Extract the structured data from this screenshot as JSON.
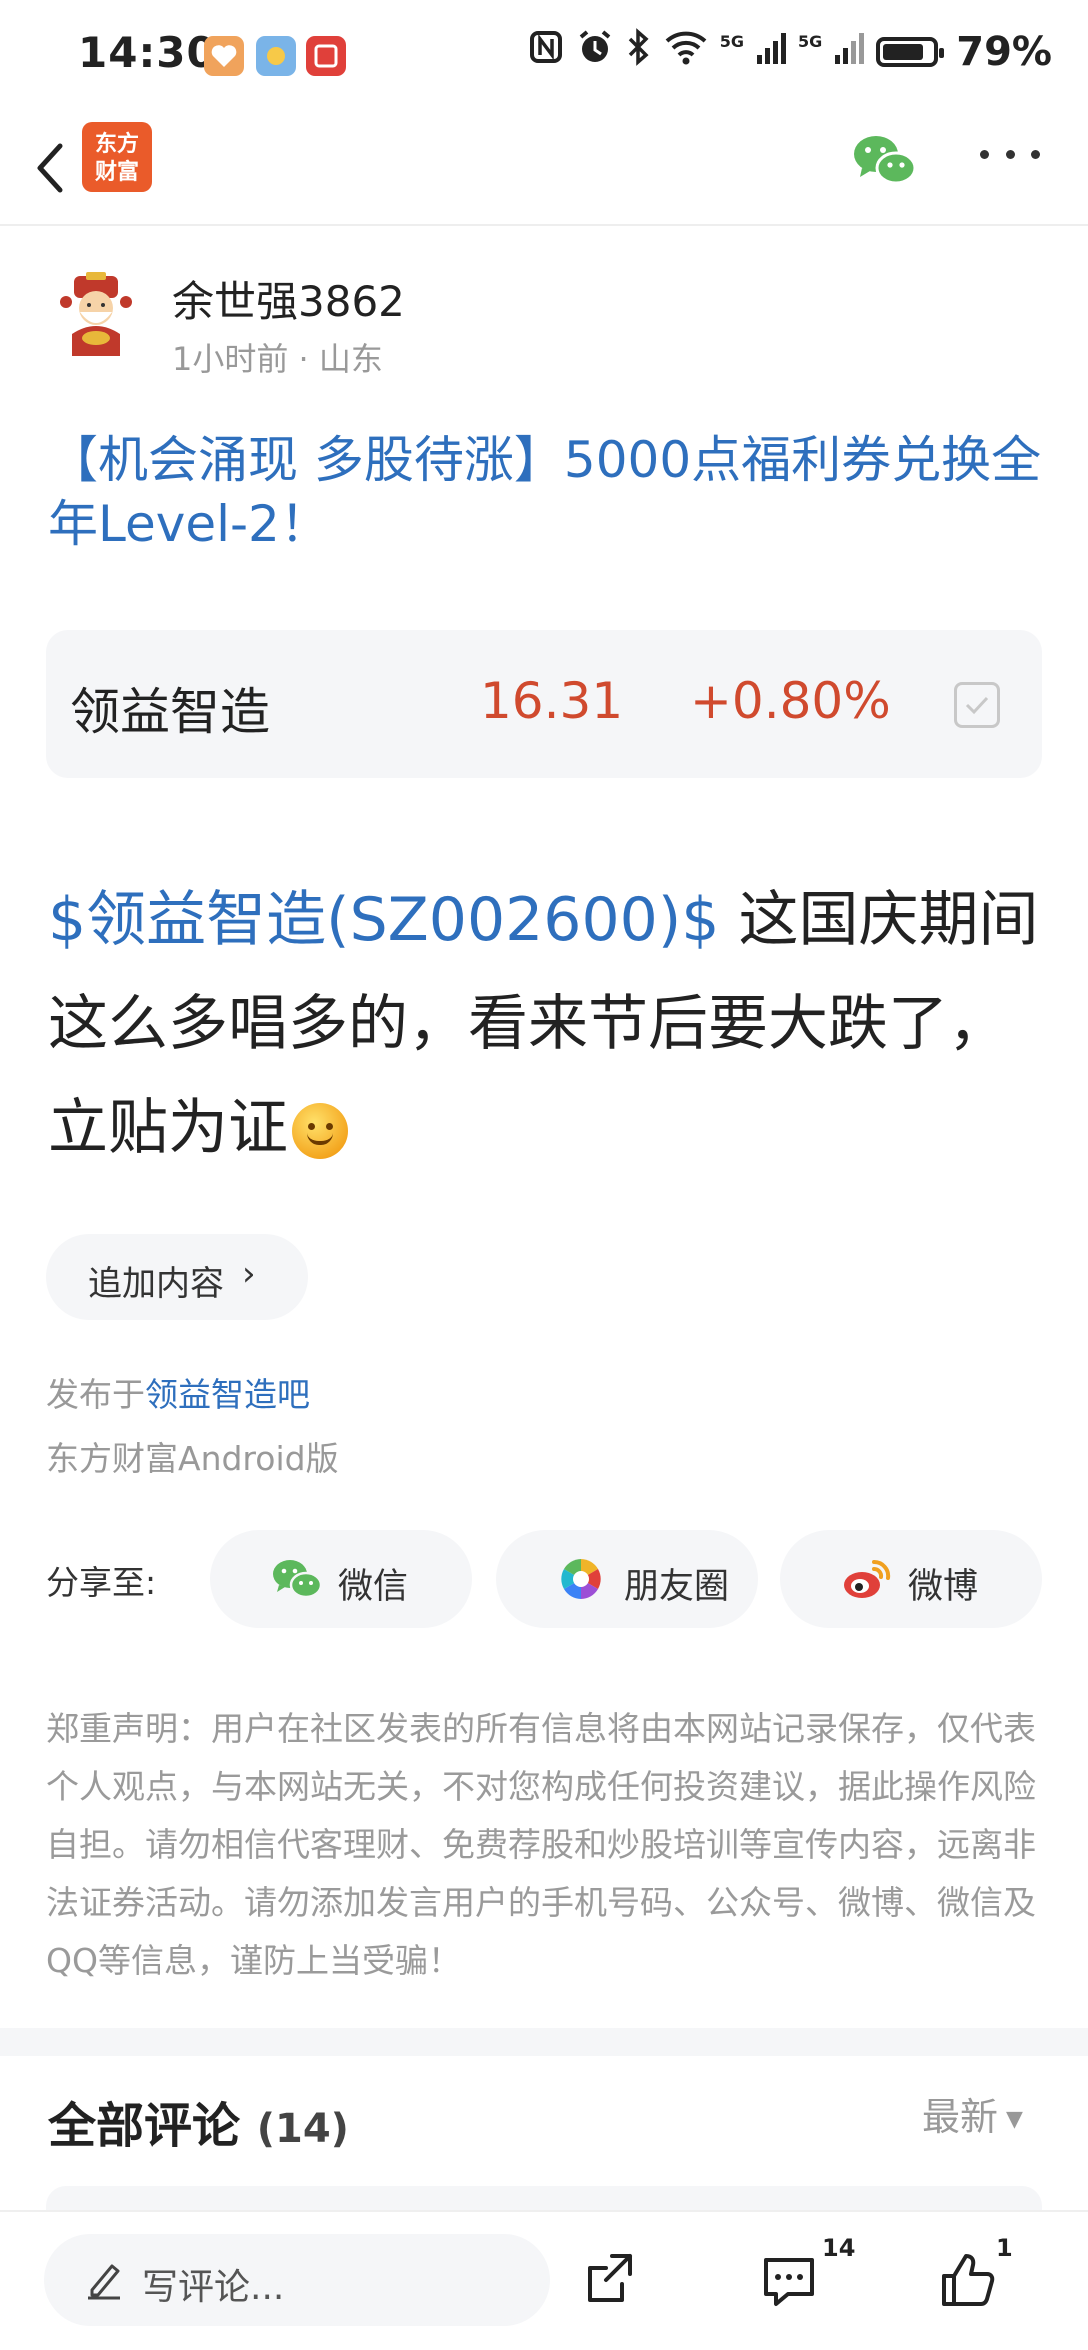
{
  "status_bar": {
    "time": "14:30",
    "network_1": "5G",
    "network_2": "5G",
    "battery": "79%"
  },
  "nav": {
    "brand_line1": "东方",
    "brand_line2": "财富"
  },
  "author": {
    "name": "余世强3862",
    "meta": "1小时前 · 山东"
  },
  "post": {
    "title": "【机会涌现 多股待涨】5000点福利券兑换全年Level-2！",
    "body_mention": "$领益智造(SZ002600)$",
    "body_text": " 这国庆期间这么多唱多的，看来节后要大跌了，立贴为证"
  },
  "stock": {
    "name": "领益智造",
    "price": "16.31",
    "change": "+0.80%"
  },
  "add_content": {
    "label": "追加内容",
    "chevron": "›"
  },
  "published": {
    "prefix": "发布于",
    "forum": "领益智造吧",
    "client": "东方财富Android版"
  },
  "share": {
    "label": "分享至:",
    "wechat": "微信",
    "moments": "朋友圈",
    "weibo": "微博"
  },
  "disclaimer": "郑重声明：用户在社区发表的所有信息将由本网站记录保存，仅代表个人观点，与本网站无关，不对您构成任何投资建议，据此操作风险自担。请勿相信代客理财、免费荐股和炒股培训等宣传内容，远离非法证券活动。请勿添加发言用户的手机号码、公众号、微博、微信及QQ等信息，谨防上当受骗！",
  "comments": {
    "title": "全部评论",
    "count": "(14)",
    "sort": "最新"
  },
  "bottom_bar": {
    "input_placeholder": "写评论...",
    "comment_count": "14",
    "like_count": "1"
  },
  "colors": {
    "link_blue": "#2e6fbd",
    "price_red": "#d04a2e",
    "brand_orange": "#ea5b2a",
    "wechat_green": "#5cb85c"
  }
}
